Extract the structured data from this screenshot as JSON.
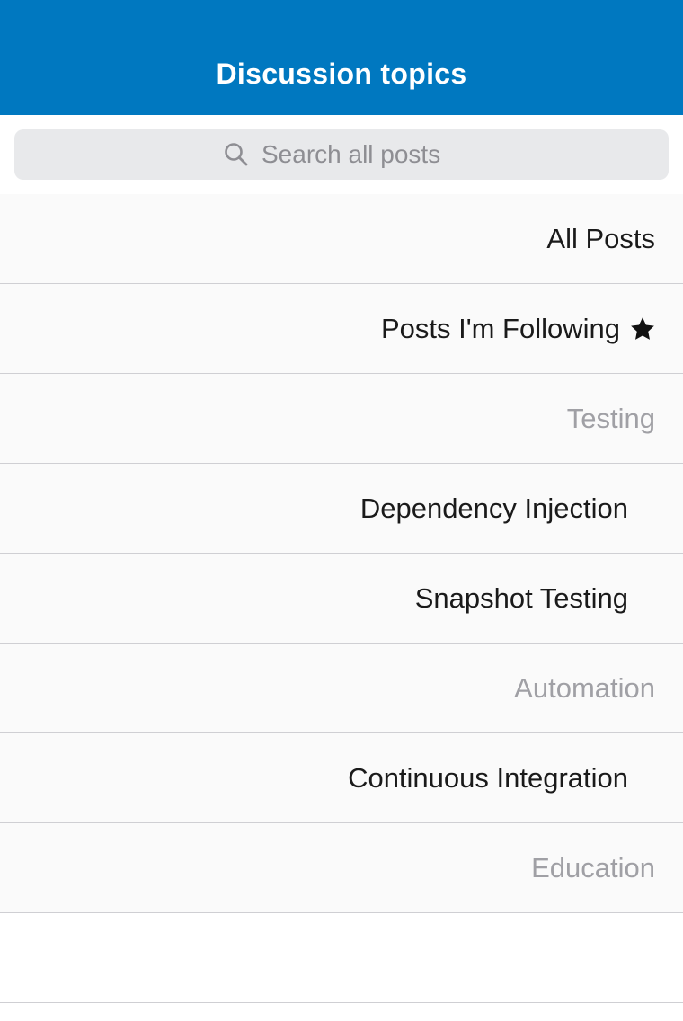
{
  "header": {
    "title": "Discussion topics",
    "background": "#0078c0"
  },
  "search": {
    "placeholder": "Search all posts",
    "value": "",
    "icon": "search-icon"
  },
  "topics": {
    "all_posts": "All Posts",
    "following": "Posts I'm Following",
    "following_icon": "star-icon",
    "section_testing": "Testing",
    "dependency_injection": "Dependency Injection",
    "snapshot_testing": "Snapshot Testing",
    "section_automation": "Automation",
    "continuous_integration": "Continuous Integration",
    "section_education": "Education"
  }
}
